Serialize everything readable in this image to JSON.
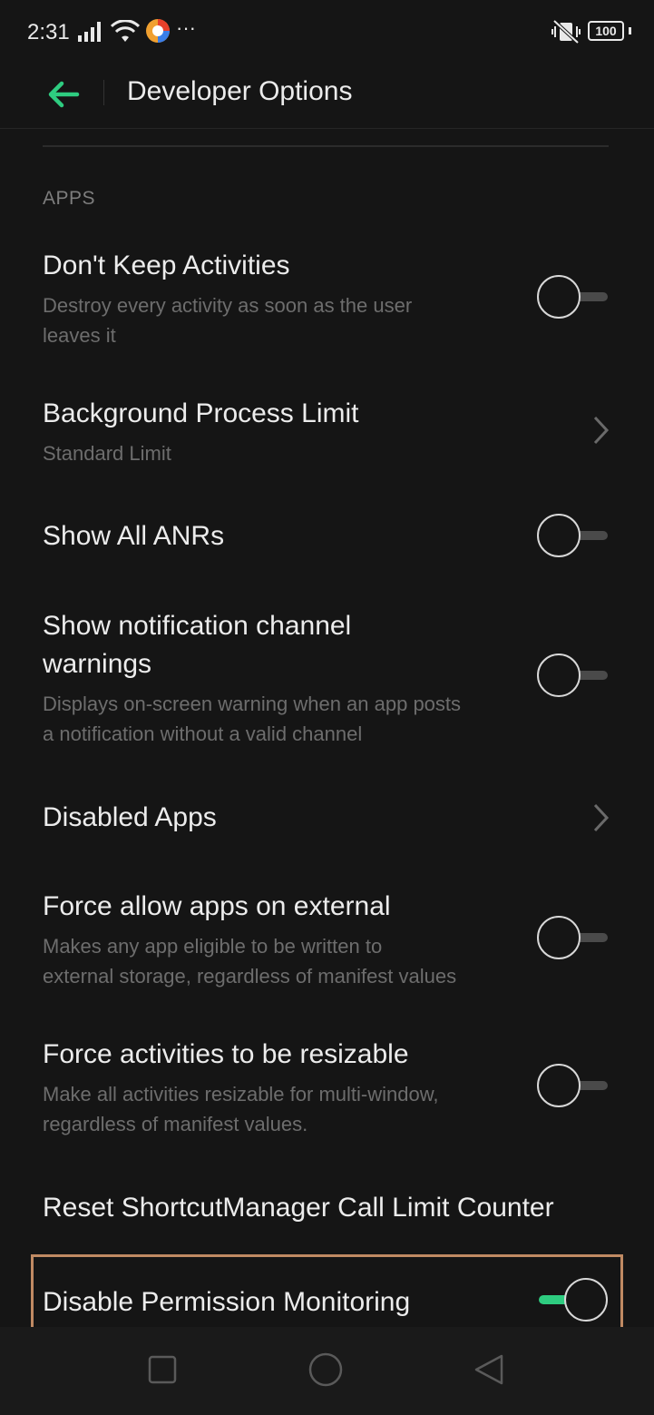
{
  "status_bar": {
    "time": "2:31",
    "battery": "100",
    "overflow": "···"
  },
  "app_bar": {
    "title": "Developer Options"
  },
  "section": {
    "header": "APPS"
  },
  "settings": {
    "dont_keep_activities": {
      "title": "Don't Keep Activities",
      "sub1": "Destroy every activity as soon as the user",
      "sub2": "leaves it",
      "enabled": false
    },
    "background_process_limit": {
      "title": "Background Process Limit",
      "value": "Standard Limit"
    },
    "show_all_anrs": {
      "title": "Show All ANRs",
      "enabled": false
    },
    "notification_channel_warnings": {
      "title1": "Show notification channel",
      "title2": "warnings",
      "sub1": "Displays on-screen warning when an app posts",
      "sub2": "a notification without a valid channel",
      "enabled": false
    },
    "disabled_apps": {
      "title": "Disabled Apps"
    },
    "force_allow_external": {
      "title": "Force allow apps on external",
      "sub1": "Makes any app eligible to be written to",
      "sub2": "external storage, regardless of manifest values",
      "enabled": false
    },
    "force_resizable": {
      "title": "Force activities to be resizable",
      "sub1": "Make all activities resizable for multi-window,",
      "sub2": "regardless of manifest values.",
      "enabled": false
    },
    "reset_shortcut_manager": {
      "title": "Reset ShortcutManager Call Limit Counter"
    },
    "disable_permission_monitoring": {
      "title": "Disable Permission Monitoring",
      "enabled": true
    }
  },
  "colors": {
    "accent": "#2ecc80",
    "background": "#151515",
    "highlight": "#c08a63"
  },
  "icons": {
    "back": "arrow-left-icon",
    "chevron": "chevron-right-icon",
    "nav_recents": "square-icon",
    "nav_home": "circle-icon",
    "nav_back": "triangle-back-icon"
  }
}
